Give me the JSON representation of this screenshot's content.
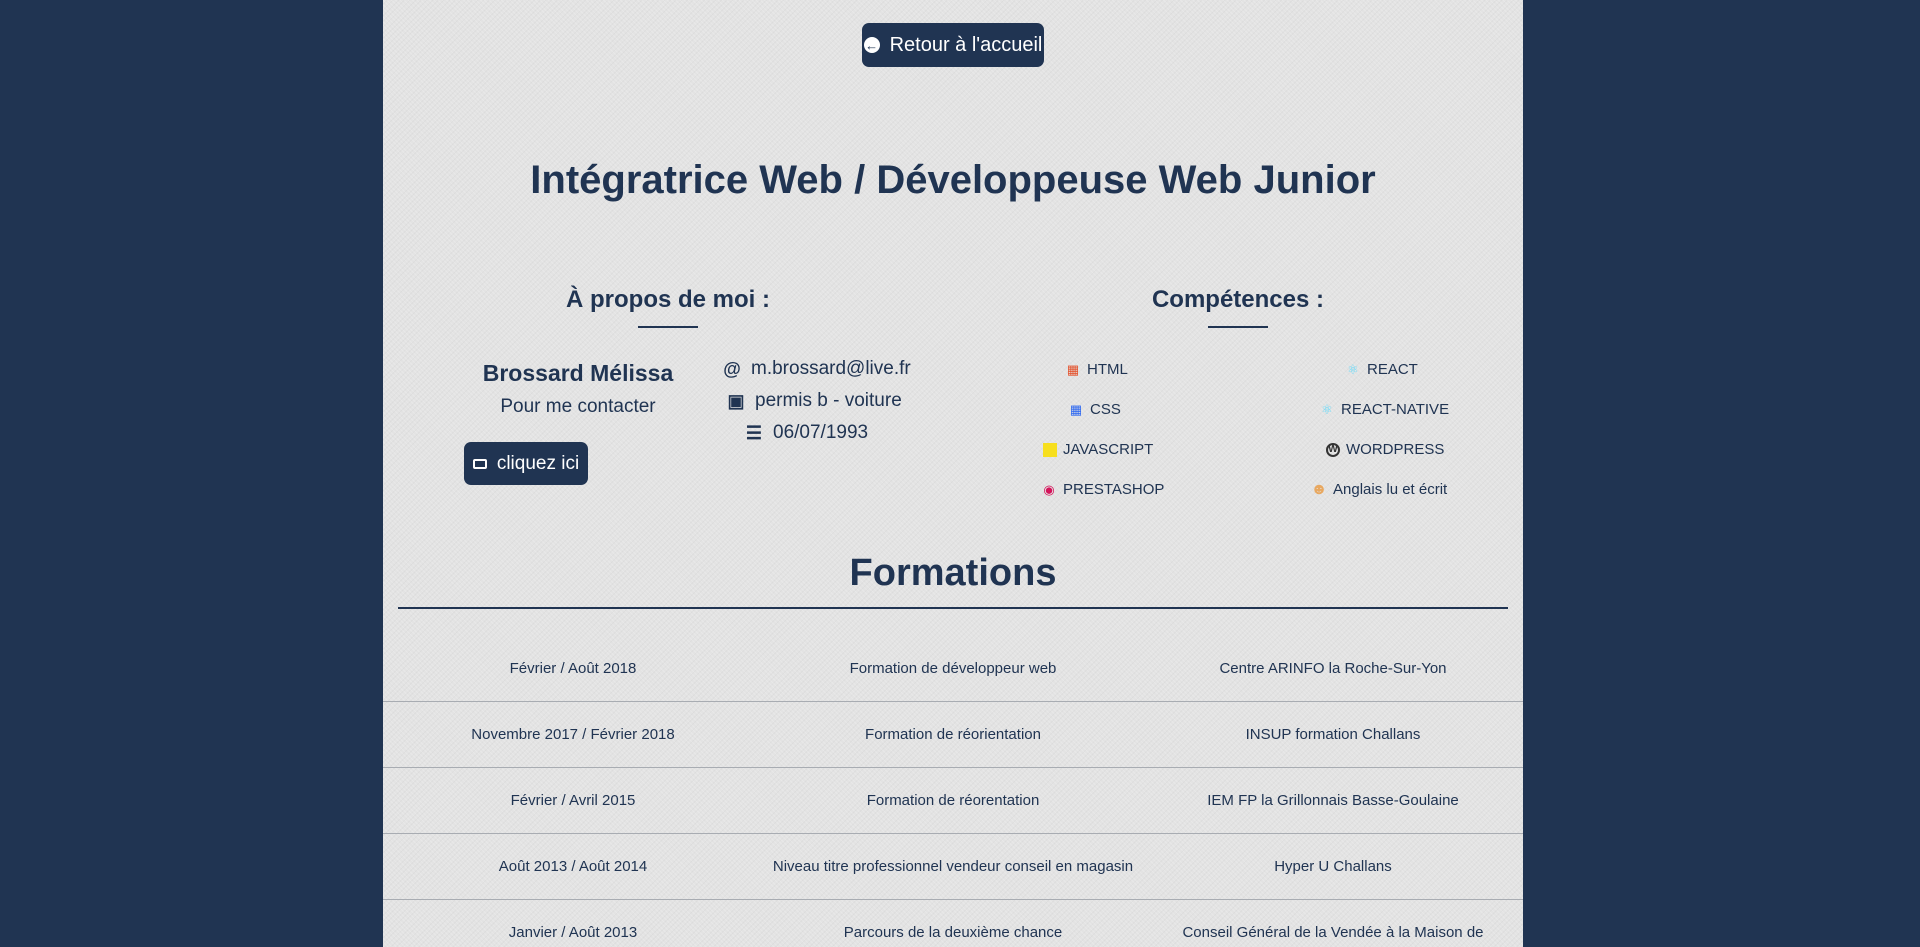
{
  "back_button": {
    "label": "Retour à l'accueil",
    "icon": "arrow-circle-left-icon"
  },
  "page_title": "Intégratrice Web / Développeuse Web Junior",
  "about": {
    "title": "À propos de moi :",
    "name": "Brossard Mélissa",
    "contact_text": "Pour me contacter",
    "contact_button": "cliquez ici",
    "email": "m.brossard@live.fr",
    "license": "permis b - voiture",
    "birthdate": "06/07/1993"
  },
  "skills": {
    "title": "Compétences :",
    "left": [
      {
        "label": "HTML",
        "icon": "html5-icon"
      },
      {
        "label": "CSS",
        "icon": "css3-icon"
      },
      {
        "label": "JAVASCRIPT",
        "icon": "javascript-icon"
      },
      {
        "label": "PRESTASHOP",
        "icon": "prestashop-icon"
      }
    ],
    "right": [
      {
        "label": "REACT",
        "icon": "react-icon"
      },
      {
        "label": "REACT-NATIVE",
        "icon": "react-icon"
      },
      {
        "label": "WORDPRESS",
        "icon": "wordpress-icon"
      },
      {
        "label": "Anglais lu et écrit",
        "icon": "english-speaker-icon"
      }
    ]
  },
  "formations": {
    "title": "Formations",
    "rows": [
      {
        "date": "Février / Août 2018",
        "title": "Formation de développeur web",
        "place": "Centre ARINFO la Roche-Sur-Yon"
      },
      {
        "date": "Novembre 2017 / Février 2018",
        "title": "Formation de réorientation",
        "place": "INSUP formation Challans"
      },
      {
        "date": "Février / Avril 2015",
        "title": "Formation de réorentation",
        "place": "IEM FP la Grillonnais Basse-Goulaine"
      },
      {
        "date": "Août 2013 / Août 2014",
        "title": "Niveau titre professionnel vendeur conseil en magasin",
        "place": "Hyper U Challans"
      },
      {
        "date": "Janvier / Août 2013",
        "title": "Parcours de la deuxième chance",
        "place": "Conseil Général de la Vendée à la Maison de"
      }
    ]
  },
  "colors": {
    "background": "#203452",
    "page": "#e3e3e3",
    "accent": "#203452",
    "html": "#e44d26",
    "css": "#2965f1",
    "javascript": "#f7df1e",
    "react": "#61dafb"
  }
}
